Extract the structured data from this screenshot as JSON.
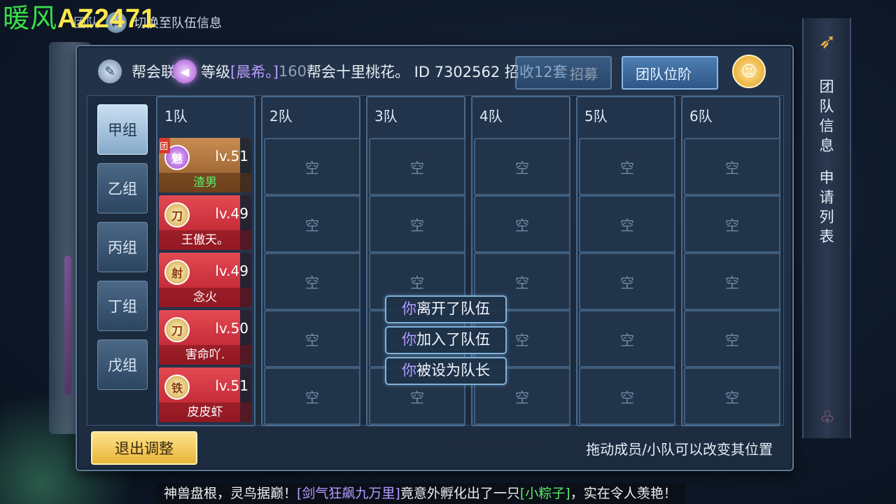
{
  "watermark": {
    "name": "暖风",
    "id": "AZ2471"
  },
  "top_strip": {
    "prev_tab": "团队",
    "switch_label": "切换至队伍信息"
  },
  "header": {
    "announce_prefix": "帮会联",
    "announce_gap": "等级",
    "player_name": "[晨希。]",
    "announce_level": "160",
    "announce_text": "帮会十里桃花。 ID 7302562 招收12套",
    "recruit_button": "招募",
    "rank_button": "团队位阶"
  },
  "groups": [
    {
      "label": "甲组",
      "active": true
    },
    {
      "label": "乙组",
      "active": false
    },
    {
      "label": "丙组",
      "active": false
    },
    {
      "label": "丁组",
      "active": false
    },
    {
      "label": "戊组",
      "active": false
    }
  ],
  "teams": [
    {
      "title": "1队"
    },
    {
      "title": "2队"
    },
    {
      "title": "3队"
    },
    {
      "title": "4队"
    },
    {
      "title": "5队"
    },
    {
      "title": "6队"
    }
  ],
  "empty_label": "空",
  "members": [
    {
      "icon": "魅",
      "level": "lv.51",
      "name": "渣男",
      "leader_badge": "团",
      "style": "gold"
    },
    {
      "icon": "刀",
      "level": "lv.49",
      "name": "王傲天。",
      "style": "red"
    },
    {
      "icon": "射",
      "level": "lv.49",
      "name": "念火",
      "style": "red"
    },
    {
      "icon": "刀",
      "level": "lv.50",
      "name": "害命吖.",
      "style": "red"
    },
    {
      "icon": "铁",
      "level": "lv.51",
      "name": "皮皮虾",
      "style": "red"
    }
  ],
  "toasts": [
    {
      "you": "你",
      "text": "离开了队伍"
    },
    {
      "you": "你",
      "text": "加入了队伍"
    },
    {
      "you": "你",
      "text": "被设为队长"
    }
  ],
  "footer": {
    "exit_button": "退出调整",
    "hint": "拖动成员/小队可以改变其位置"
  },
  "side_scroll": {
    "tab1": "团队信息",
    "tab2": "申请列表"
  },
  "chat": {
    "part1": "神兽盘根，灵鸟据巅！",
    "player": "[剑气狂飙九万里]",
    "part2": "竟意外孵化出了一只",
    "item": "[小粽子]",
    "part3": "，实在令人羡艳！"
  }
}
